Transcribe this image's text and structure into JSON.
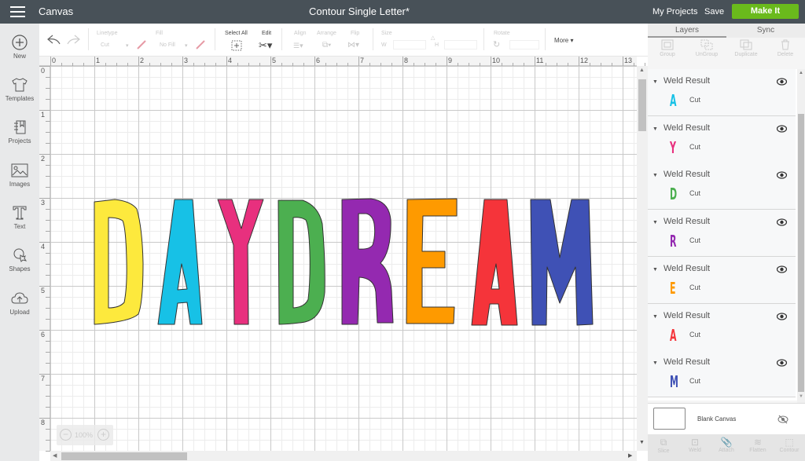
{
  "topbar": {
    "app_title": "Canvas",
    "document_title": "Contour Single Letter*",
    "my_projects": "My Projects",
    "save": "Save",
    "make_it": "Make It",
    "make_it_color": "#6aba1c"
  },
  "sidebar": {
    "items": [
      {
        "label": "New",
        "icon": "plus-circle-icon"
      },
      {
        "label": "Templates",
        "icon": "tshirt-icon"
      },
      {
        "label": "Projects",
        "icon": "notebook-icon"
      },
      {
        "label": "Images",
        "icon": "image-icon"
      },
      {
        "label": "Text",
        "icon": "text-icon"
      },
      {
        "label": "Shapes",
        "icon": "shapes-icon"
      },
      {
        "label": "Upload",
        "icon": "cloud-upload-icon"
      }
    ]
  },
  "toolbar": {
    "linetype_label": "Linetype",
    "linetype_value": "Cut",
    "fill_label": "Fill",
    "fill_value": "No Fill",
    "select_all": "Select All",
    "edit": "Edit",
    "align": "Align",
    "arrange": "Arrange",
    "flip": "Flip",
    "size": "Size",
    "width_label": "W",
    "height_label": "H",
    "rotate": "Rotate",
    "more": "More"
  },
  "rulers": {
    "horizontal": [
      "0",
      "1",
      "2",
      "3",
      "4",
      "5",
      "6",
      "7",
      "8",
      "9",
      "10",
      "11",
      "12",
      "13"
    ],
    "vertical": [
      "0",
      "1",
      "2",
      "3",
      "4",
      "5",
      "6",
      "7",
      "8"
    ]
  },
  "zoom": {
    "level": "100%"
  },
  "canvas": {
    "word": "DAYDREAM",
    "letters": [
      {
        "char": "D",
        "color": "#fde93d"
      },
      {
        "char": "A",
        "color": "#17c1e6"
      },
      {
        "char": "Y",
        "color": "#e8307e"
      },
      {
        "char": "D",
        "color": "#4caf50"
      },
      {
        "char": "R",
        "color": "#9429b0"
      },
      {
        "char": "E",
        "color": "#fe9a00"
      },
      {
        "char": "A",
        "color": "#f5343a"
      },
      {
        "char": "M",
        "color": "#3f51b5"
      }
    ]
  },
  "panel": {
    "tabs": [
      {
        "label": "Layers",
        "active": true
      },
      {
        "label": "Sync",
        "active": false
      }
    ],
    "actions": [
      "Group",
      "UnGroup",
      "Duplicate",
      "Delete"
    ],
    "layers": [
      {
        "name": "Weld Result",
        "type": "Cut",
        "thumb": "A",
        "color": "#17c1e6"
      },
      {
        "name": "Weld Result",
        "type": "Cut",
        "thumb": "Y",
        "color": "#e8307e"
      },
      {
        "name": "Weld Result",
        "type": "Cut",
        "thumb": "D",
        "color": "#4caf50"
      },
      {
        "name": "Weld Result",
        "type": "Cut",
        "thumb": "R",
        "color": "#9429b0"
      },
      {
        "name": "Weld Result",
        "type": "Cut",
        "thumb": "E",
        "color": "#fe9a00"
      },
      {
        "name": "Weld Result",
        "type": "Cut",
        "thumb": "A",
        "color": "#f5343a"
      },
      {
        "name": "Weld Result",
        "type": "Cut",
        "thumb": "M",
        "color": "#3f51b5"
      }
    ],
    "blank_canvas": "Blank Canvas",
    "bottom_actions": [
      "Slice",
      "Weld",
      "Attach",
      "Flatten",
      "Contour"
    ]
  }
}
